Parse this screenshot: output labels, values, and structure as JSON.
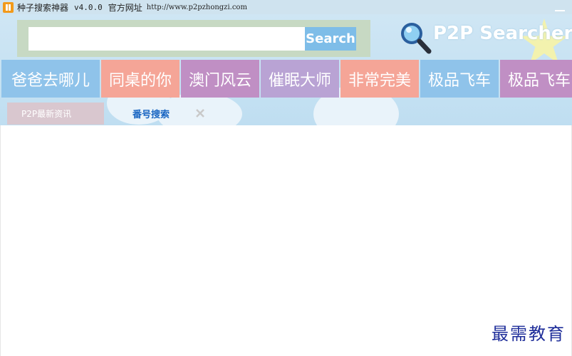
{
  "titlebar": {
    "app_name": "种子搜索神器",
    "version": "v4.0.0",
    "site_label": "官方网址",
    "url": "http://www.p2pzhongzi.com"
  },
  "search": {
    "value": "",
    "button_label": "Search"
  },
  "brand": {
    "name": "P2P Searcher"
  },
  "hot_keywords": [
    {
      "label": "爸爸去哪儿",
      "color": "#8fc3ea"
    },
    {
      "label": "同桌的你",
      "color": "#f5a597"
    },
    {
      "label": "澳门风云",
      "color": "#c08fc4"
    },
    {
      "label": "催眠大师",
      "color": "#b9a3d4"
    },
    {
      "label": "非常完美",
      "color": "#f5a597"
    },
    {
      "label": "极品飞车",
      "color": "#8fc3ea"
    },
    {
      "label": "极品飞车",
      "color": "#c08fc4"
    }
  ],
  "tabs": {
    "news_label": "P2P最新资讯",
    "search_label": "番号搜索"
  },
  "watermark": "最需教育",
  "icons": {
    "app": "app-logo-icon",
    "brand": "magnifier-icon",
    "close": "close-icon"
  }
}
